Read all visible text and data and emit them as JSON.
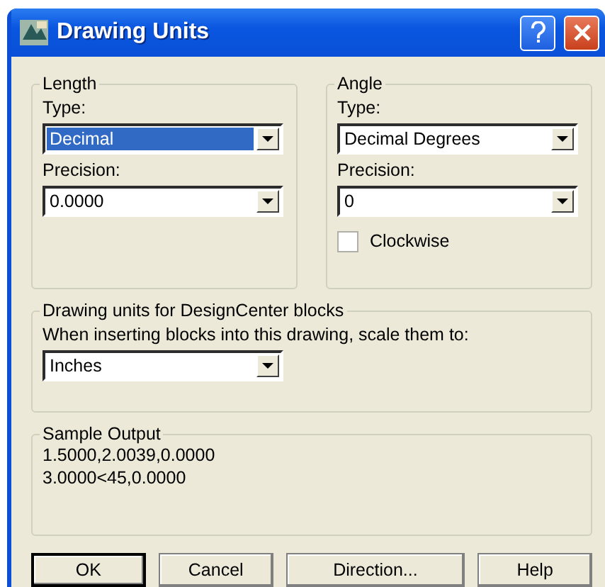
{
  "window": {
    "title": "Drawing Units"
  },
  "length": {
    "title": "Length",
    "type": {
      "label": "Type:",
      "value": "Decimal",
      "highlighted": true
    },
    "precision": {
      "label": "Precision:",
      "value": "0.0000",
      "highlighted": false
    }
  },
  "angle": {
    "title": "Angle",
    "type": {
      "label": "Type:",
      "value": "Decimal Degrees",
      "highlighted": false
    },
    "precision": {
      "label": "Precision:",
      "value": "0",
      "highlighted": false
    },
    "clockwise": {
      "label": "Clockwise",
      "checked": false
    }
  },
  "designcenter": {
    "title": "Drawing units for DesignCenter blocks",
    "prompt": "When inserting blocks into this drawing, scale them to:",
    "units": {
      "value": "Inches",
      "highlighted": false
    }
  },
  "sample_output": {
    "title": "Sample Output",
    "lines": [
      "1.5000,2.0039,0.0000",
      "3.0000<45,0.0000"
    ]
  },
  "buttons": [
    {
      "label": "OK",
      "default": true
    },
    {
      "label": "Cancel",
      "default": false
    },
    {
      "label": "Direction...",
      "default": false
    },
    {
      "label": "Help",
      "default": false
    }
  ]
}
